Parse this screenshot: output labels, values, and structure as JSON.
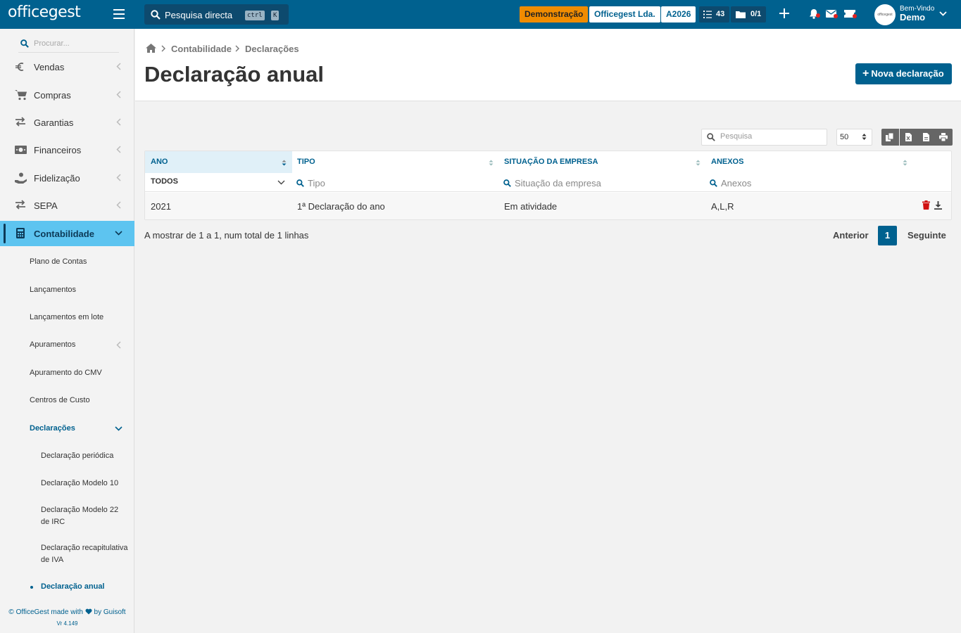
{
  "topbar": {
    "logo": "officegest",
    "search_label": "Pesquisa directa",
    "kbd_ctrl": "ctrl",
    "kbd_k": "K",
    "demo_badge": "Demonstração",
    "company_badge": "Officegest Lda.",
    "year_badge": "A2026",
    "tasks_count": "43",
    "docs_count": "0/1",
    "user_greeting": "Bem-Vindo",
    "user_name": "Demo"
  },
  "sidebar": {
    "search_placeholder": "Procurar...",
    "items": [
      {
        "label": "Vendas",
        "icon": "euro-icon"
      },
      {
        "label": "Compras",
        "icon": "cart-icon"
      },
      {
        "label": "Garantias",
        "icon": "exchange-icon"
      },
      {
        "label": "Financeiros",
        "icon": "money-icon"
      },
      {
        "label": "Fidelização",
        "icon": "hand-coin-icon"
      },
      {
        "label": "SEPA",
        "icon": "exchange-icon"
      },
      {
        "label": "Contabilidade",
        "icon": "calculator-icon"
      }
    ],
    "sub_items": [
      "Plano de Contas",
      "Lançamentos",
      "Lançamentos em lote",
      "Apuramentos",
      "Apuramento do CMV",
      "Centros de Custo",
      "Declarações"
    ],
    "declaracoes": [
      "Declaração periódica",
      "Declaração Modelo 10",
      "Declaração Modelo 22 de IRC",
      "Declaração recapitulativa de IVA",
      "Declaração anual"
    ],
    "footer_line1": "© OfficeGest made with",
    "footer_line2": "by Guisoft",
    "version": "Vr 4.149"
  },
  "header": {
    "breadcrumb": [
      "Contabilidade",
      "Declarações"
    ],
    "title": "Declaração anual",
    "new_button": "Nova declaração"
  },
  "table": {
    "search_placeholder": "Pesquisa",
    "page_size": "50",
    "columns": [
      "ANO",
      "TIPO",
      "SITUAÇÃO DA EMPRESA",
      "ANEXOS"
    ],
    "filters": {
      "ano": "TODOS",
      "tipo": "Tipo",
      "situacao": "Situação da empresa",
      "anexos": "Anexos"
    },
    "rows": [
      {
        "ano": "2021",
        "tipo": "1ª Declaração do ano",
        "situacao": "Em atividade",
        "anexos": "A,L,R"
      }
    ]
  },
  "pagination": {
    "info": "A mostrar de 1 a 1, num total de 1 linhas",
    "prev": "Anterior",
    "current": "1",
    "next": "Seguinte"
  },
  "colors": {
    "brand": "#00618f",
    "active_menu": "#5dc4f0",
    "demo_badge": "#f08c00",
    "delete_red": "#d01010"
  }
}
